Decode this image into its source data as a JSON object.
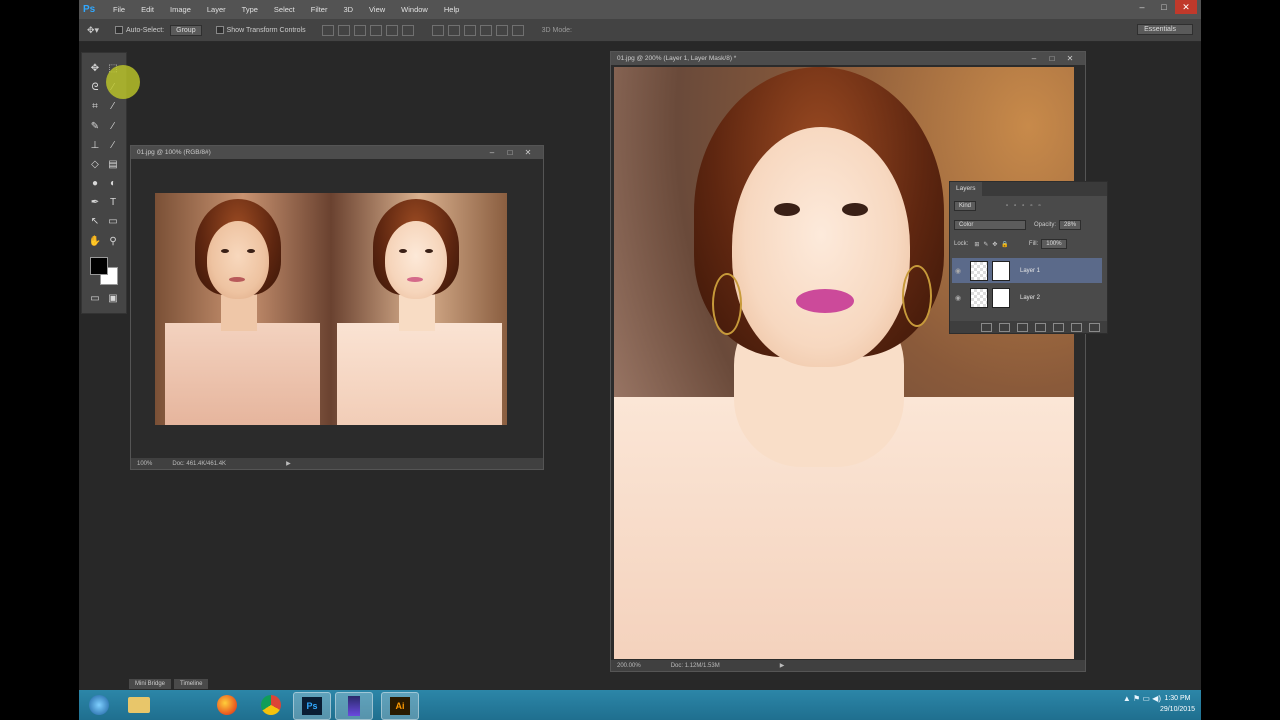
{
  "menubar": {
    "logo": "Ps",
    "items": [
      "File",
      "Edit",
      "Image",
      "Layer",
      "Type",
      "Select",
      "Filter",
      "3D",
      "View",
      "Window",
      "Help"
    ]
  },
  "window_controls": {
    "minimize": "–",
    "maximize": "□",
    "close": "✕"
  },
  "options": {
    "tool_icon": "move-icon",
    "auto_select_label": "Auto-Select:",
    "auto_select_value": "Group",
    "transform_label": "Show Transform Controls",
    "mode_3d_label": "3D Mode:",
    "workspace": "Essentials"
  },
  "doc_small": {
    "title": "01.jpg @ 100% (RGB/8#)",
    "zoom": "100%",
    "doc_info": "Doc: 461.4K/461.4K"
  },
  "doc_large": {
    "title": "01.jpg @ 200% (Layer 1, Layer Mask/8) *",
    "zoom": "200.00%",
    "doc_info": "Doc: 1.12M/1.53M"
  },
  "layers_panel": {
    "tab": "Layers",
    "filter_kind": "Kind",
    "blend_mode": "Color",
    "opacity_label": "Opacity:",
    "opacity_value": "28%",
    "lock_label": "Lock:",
    "fill_label": "Fill:",
    "fill_value": "100%",
    "layers": [
      {
        "name": "Layer 1",
        "selected": true
      },
      {
        "name": "Layer 2",
        "selected": false
      }
    ]
  },
  "bottom_tabs": [
    "Mini Bridge",
    "Timeline"
  ],
  "taskbar": {
    "apps": [
      "windows-start-icon",
      "file-explorer-icon",
      "firefox-icon",
      "chrome-icon",
      "photoshop-icon",
      "media-app-icon",
      "illustrator-icon"
    ],
    "app_labels": {
      "photoshop": "Ps",
      "illustrator": "Ai"
    },
    "time": "1:30 PM",
    "date": "29/10/2015"
  },
  "colors": {
    "accent": "#31a8ff",
    "taskbar": "#2284a8",
    "selected_layer": "#5b6a8a"
  }
}
